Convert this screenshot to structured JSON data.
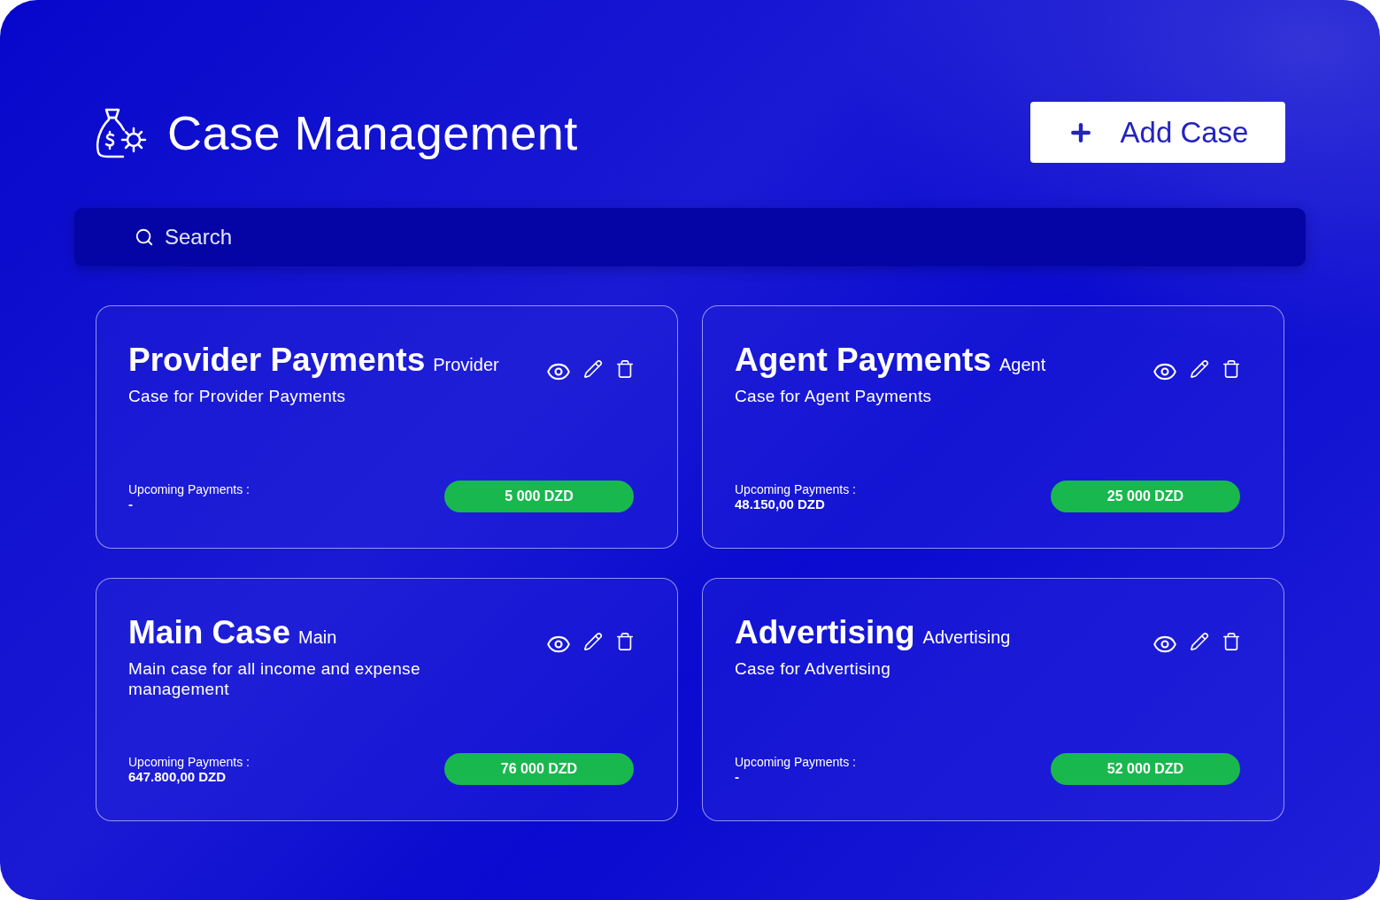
{
  "header": {
    "title": "Case Management",
    "add_button": "Add Case"
  },
  "search": {
    "placeholder": "Search"
  },
  "cases": [
    {
      "name": "Provider Payments",
      "tag": "Provider",
      "description": "Case for Provider Payments",
      "upcoming_label": "Upcoming Payments :",
      "upcoming_value": "-",
      "balance": "5 000 DZD"
    },
    {
      "name": "Agent Payments",
      "tag": "Agent",
      "description": "Case for Agent Payments",
      "upcoming_label": "Upcoming Payments :",
      "upcoming_value": "48.150,00 DZD",
      "balance": "25 000 DZD"
    },
    {
      "name": "Main Case",
      "tag": "Main",
      "description": "Main case for all income and expense management",
      "upcoming_label": "Upcoming Payments :",
      "upcoming_value": "647.800,00 DZD",
      "balance": "76 000 DZD"
    },
    {
      "name": "Advertising",
      "tag": "Advertising",
      "description": "Case for Advertising",
      "upcoming_label": "Upcoming Payments :",
      "upcoming_value": "-",
      "balance": "52 000 DZD"
    }
  ]
}
